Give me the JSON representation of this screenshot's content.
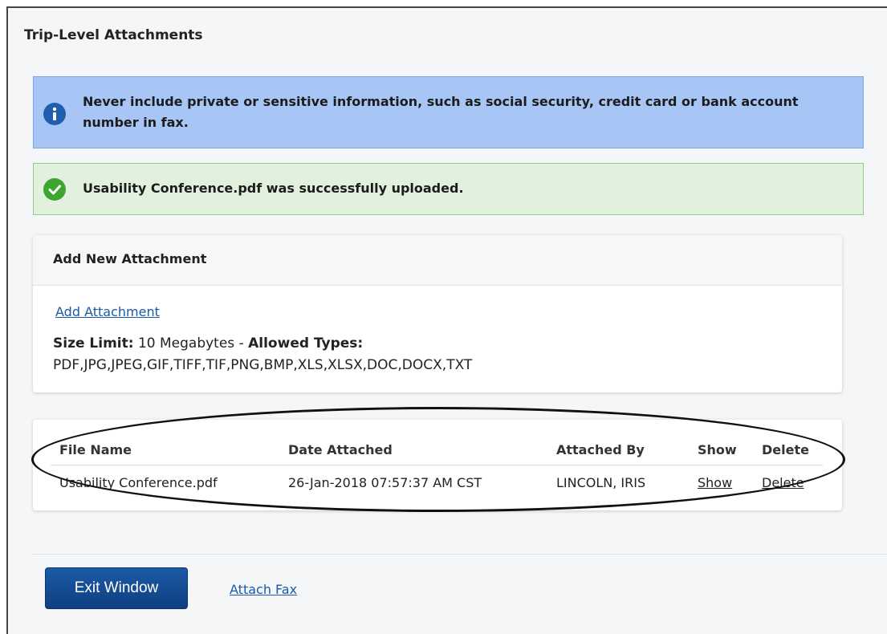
{
  "page": {
    "title": "Trip-Level Attachments"
  },
  "alerts": {
    "info": {
      "icon": "info-icon",
      "text": "Never include private or sensitive information, such as social security, credit card or bank account number in fax.",
      "color": "#a8c6f5"
    },
    "success": {
      "icon": "checkmark-icon",
      "text": "Usability Conference.pdf was successfully uploaded.",
      "color": "#e2f1dd"
    }
  },
  "add_attachment": {
    "header": "Add New Attachment",
    "link_label": "Add Attachment",
    "size_limit_label": "Size Limit:",
    "size_limit_value": "10 Megabytes",
    "separator": "-",
    "allowed_types_label": "Allowed Types:",
    "allowed_types_value": "PDF,JPG,JPEG,GIF,TIFF,TIF,PNG,BMP,XLS,XLSX,DOC,DOCX,TXT"
  },
  "table": {
    "columns": [
      "File Name",
      "Date Attached",
      "Attached By",
      "Show",
      "Delete"
    ],
    "rows": [
      {
        "file_name": "Usability Conference.pdf",
        "date_attached": "26-Jan-2018 07:57:37 AM CST",
        "attached_by": "LINCOLN, IRIS",
        "show": "Show",
        "delete": "Delete"
      }
    ]
  },
  "footer": {
    "exit_label": "Exit Window",
    "fax_label": "Attach Fax",
    "accent": "#1c5aa6"
  }
}
